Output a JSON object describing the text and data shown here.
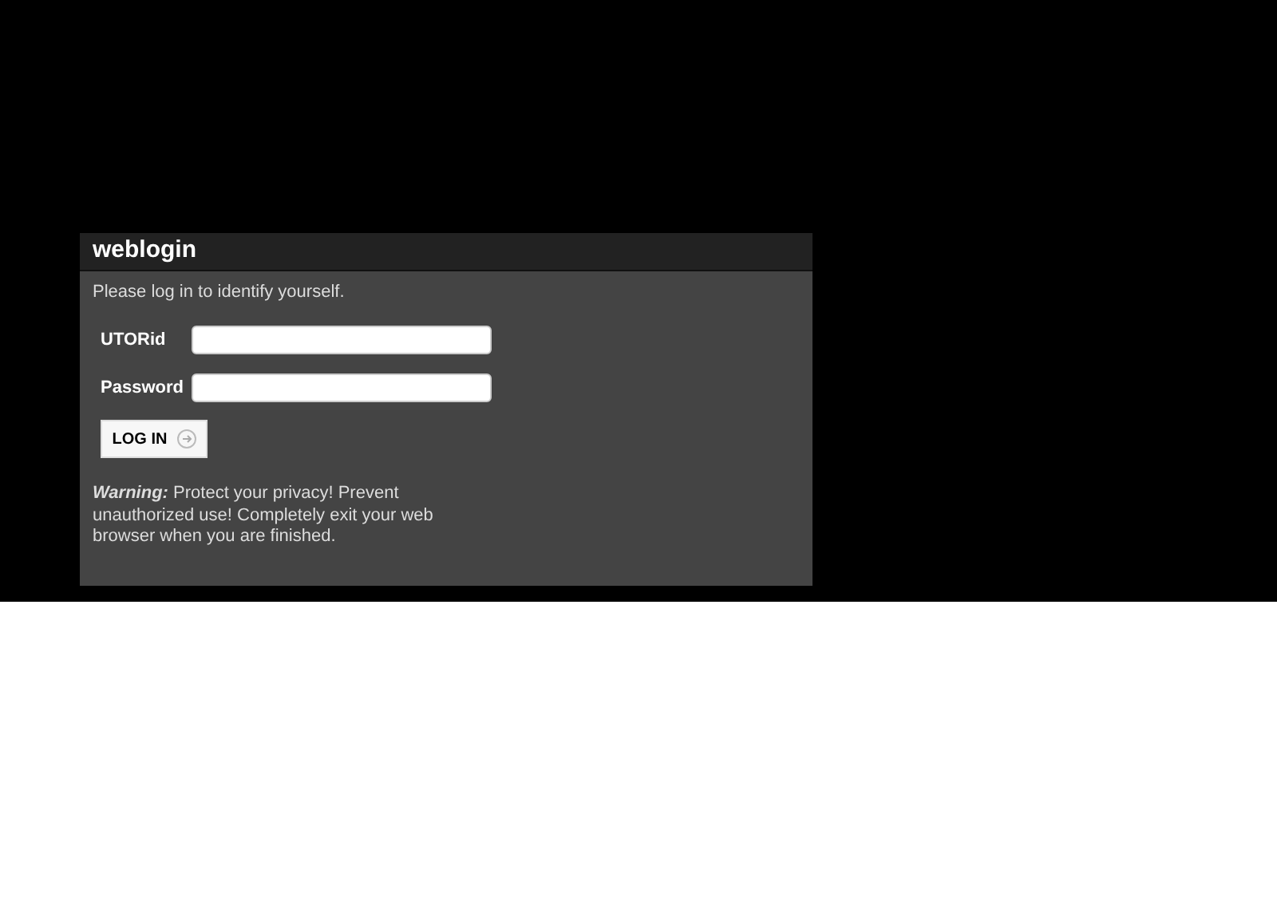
{
  "panel": {
    "title": "weblogin",
    "intro": "Please log in to identify yourself.",
    "fields": [
      {
        "label": "UTORid"
      },
      {
        "label": "Password"
      }
    ],
    "button": {
      "label": "LOG IN"
    },
    "warning_label": "Warning:",
    "warning": "Protect your privacy! Prevent unauthorized use! Completely exit your web browser when you are finished."
  }
}
